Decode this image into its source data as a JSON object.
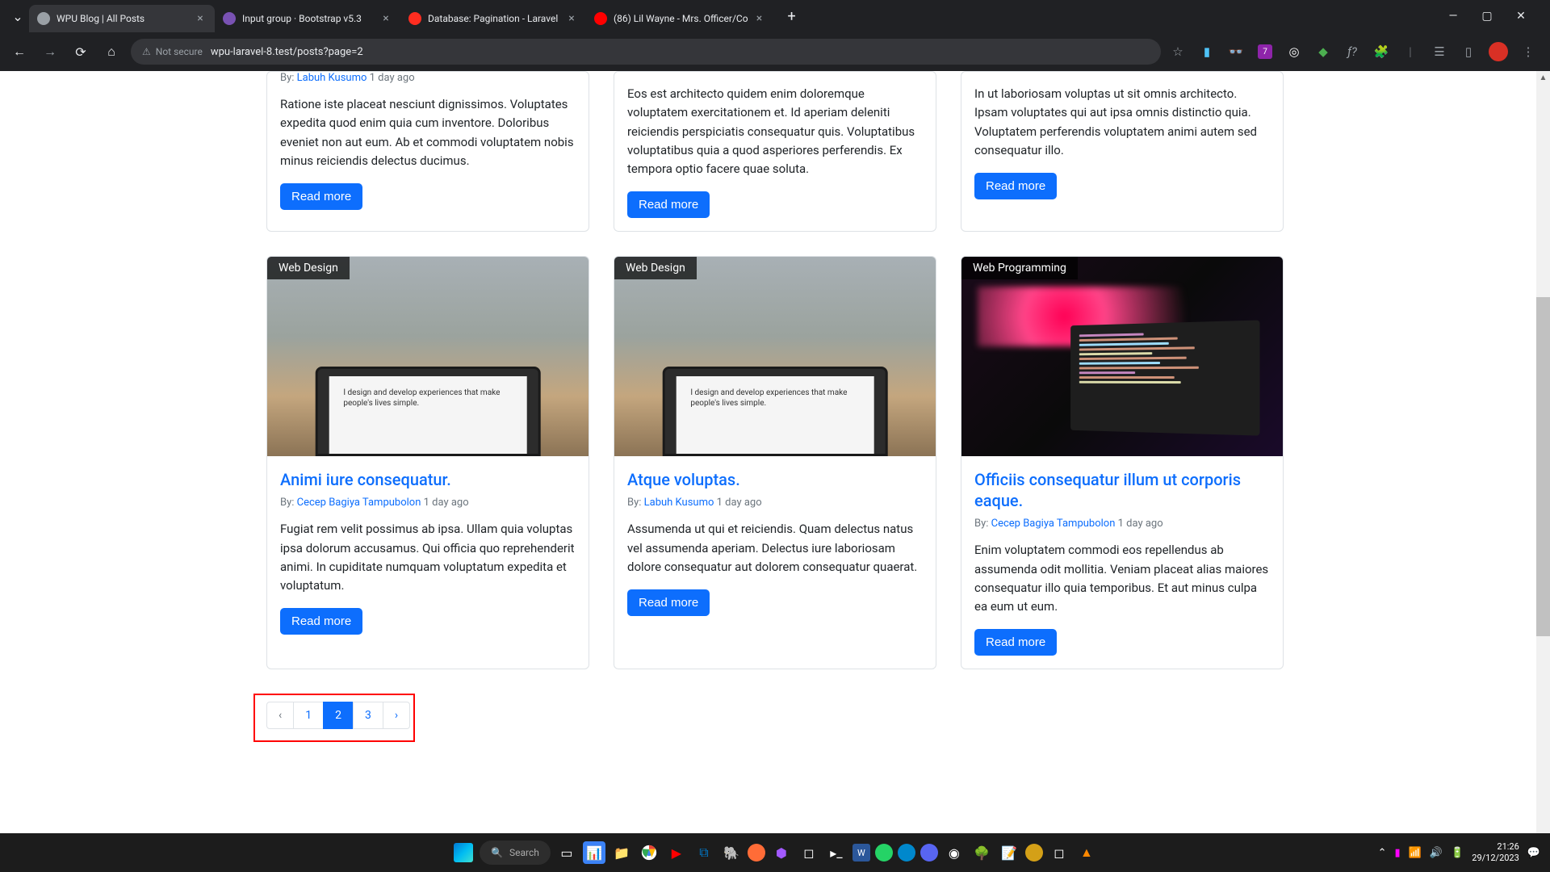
{
  "browser": {
    "tabs": [
      {
        "title": "WPU Blog | All Posts",
        "active": true,
        "favicon": "#9aa0a6"
      },
      {
        "title": "Input group · Bootstrap v5.3",
        "active": false,
        "favicon": "#7952b3"
      },
      {
        "title": "Database: Pagination - Laravel",
        "active": false,
        "favicon": "#ff2d20"
      },
      {
        "title": "(86) Lil Wayne - Mrs. Officer/Co",
        "active": false,
        "favicon": "#ff0000"
      }
    ],
    "security_label": "Not secure",
    "url": "wpu-laravel-8.test/posts?page=2",
    "toolbar_badge": "7"
  },
  "cards_top": [
    {
      "by_prefix": "By: ",
      "author": "Labuh Kusumo",
      "time": " 1 day ago",
      "text": "Ratione iste placeat nesciunt dignissimos. Voluptates expedita quod enim quia cum inventore. Doloribus eveniet non aut eum. Ab et commodi voluptatem nobis minus reiciendis delectus ducimus.",
      "btn": "Read more"
    },
    {
      "text": "Eos est architecto quidem enim doloremque voluptatem exercitationem et. Id aperiam deleniti reiciendis perspiciatis consequatur quis. Voluptatibus voluptatibus quia a quod asperiores perferendis. Ex tempora optio facere quae soluta.",
      "btn": "Read more"
    },
    {
      "text": "In ut laboriosam voluptas ut sit omnis architecto. Ipsam voluptates qui aut ipsa omnis distinctio quia. Voluptatem perferendis voluptatem animi autem sed consequatur illo.",
      "btn": "Read more"
    }
  ],
  "cards_bottom": [
    {
      "category": "Web Design",
      "title": "Animi iure consequatur.",
      "by_prefix": "By: ",
      "author": "Cecep Bagiya Tampubolon",
      "time": " 1 day ago",
      "text": "Fugiat rem velit possimus ab ipsa. Ullam quia voluptas ipsa dolorum accusamus. Qui officia quo reprehenderit animi. In cupiditate numquam voluptatum expedita et voluptatum.",
      "btn": "Read more",
      "img_type": "desk",
      "laptop_text": "I design and develop experiences that make people's lives simple."
    },
    {
      "category": "Web Design",
      "title": "Atque voluptas.",
      "by_prefix": "By: ",
      "author": "Labuh Kusumo",
      "time": " 1 day ago",
      "text": "Assumenda ut qui et reiciendis. Quam delectus natus vel assumenda aperiam. Delectus iure laboriosam dolore consequatur aut dolorem consequatur quaerat.",
      "btn": "Read more",
      "img_type": "desk",
      "laptop_text": "I design and develop experiences that make people's lives simple."
    },
    {
      "category": "Web Programming",
      "title": "Officiis consequatur illum ut corporis eaque.",
      "by_prefix": "By: ",
      "author": "Cecep Bagiya Tampubolon",
      "time": " 1 day ago",
      "text": "Enim voluptatem commodi eos repellendus ab assumenda odit mollitia. Veniam placeat alias maiores consequatur illo quia temporibus. Et aut minus culpa ea eum ut eum.",
      "btn": "Read more",
      "img_type": "code"
    }
  ],
  "pagination": {
    "prev": "‹",
    "pages": [
      "1",
      "2",
      "3"
    ],
    "active_index": 1,
    "next": "›"
  },
  "taskbar": {
    "search": "Search",
    "time": "21:26",
    "date": "29/12/2023"
  }
}
